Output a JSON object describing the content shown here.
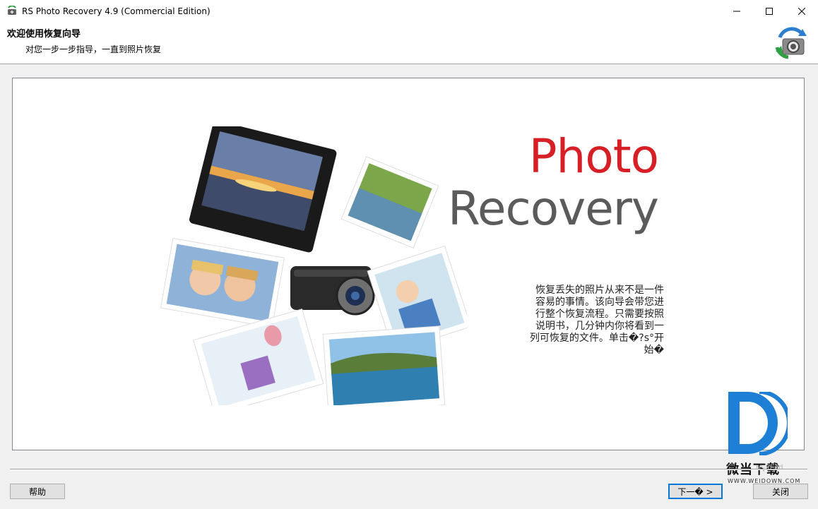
{
  "window": {
    "title": "RS Photo Recovery 4.9 (Commercial Edition)",
    "controls": [
      "minimize-icon",
      "maximize-icon",
      "close-icon"
    ]
  },
  "header": {
    "title": "欢迎使用恢复向导",
    "subtitle": "对您一步一步指导，一直到照片恢复",
    "logo_icon": "camera-recovery-icon"
  },
  "main": {
    "brand_word1": "Photo",
    "brand_word2": "Recovery",
    "description": "恢复丢失的照片从来不是一件\n容易的事情。该向导会带您进\n行整个恢复流程。只需要按照\n说明书，几分钟内你将看到一\n列可恢复的文件。单击�?s°开\n始�",
    "illustration": "camera-and-photos-illustration"
  },
  "footer": {
    "help_label": "帮助",
    "next_label": "下一� >",
    "close_label": "关闭"
  },
  "watermark": {
    "site_partial": "re-ld.dd",
    "brand_cn": "微当下载",
    "brand_url": "WWW.WEIDOWN.COM"
  },
  "colors": {
    "brand_red": "#d71f26",
    "brand_gray": "#5b5b5b",
    "accent_blue": "#0078d7",
    "watermark_blue": "#1d7fd6"
  }
}
